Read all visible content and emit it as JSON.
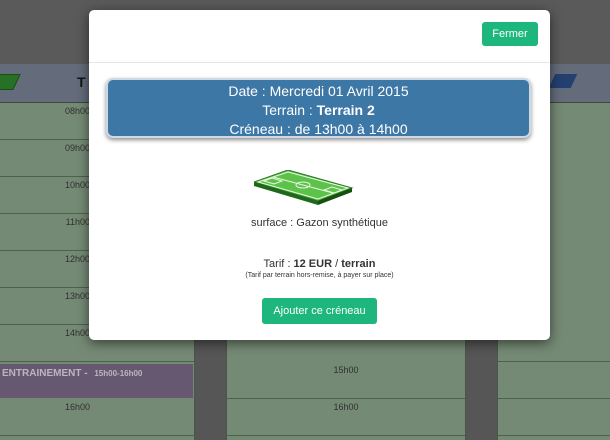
{
  "modal": {
    "close_label": "Fermer",
    "date_label": "Date : ",
    "date_value": "Mercredi 01 Avril 2015",
    "terrain_label": "Terrain : ",
    "terrain_value": "Terrain 2",
    "creneau_label": "Créneau : de 13h00 à 14h00",
    "surface_text": "surface : Gazon synthétique",
    "tarif_label": "Tarif : ",
    "tarif_price": "12 EUR",
    "tarif_sep": " / ",
    "tarif_unit": "terrain",
    "tarif_note": "(Tarif par terrain hors-remise, à payer sur place)",
    "add_label": "Ajouter ce créneau"
  },
  "background": {
    "column_title_fragment": "T",
    "left_slots": [
      "08h00",
      "09h00",
      "10h00",
      "11h00",
      "12h00",
      "13h00",
      "14h00"
    ],
    "left_bottom_slot": "16h00",
    "mid_slots": [
      "15h00",
      "16h00"
    ],
    "event_title": "ENTRAINEMENT -",
    "event_time": "15h00-16h00"
  },
  "colors": {
    "button_green": "#1db67c",
    "info_blue": "#3d77a6"
  }
}
